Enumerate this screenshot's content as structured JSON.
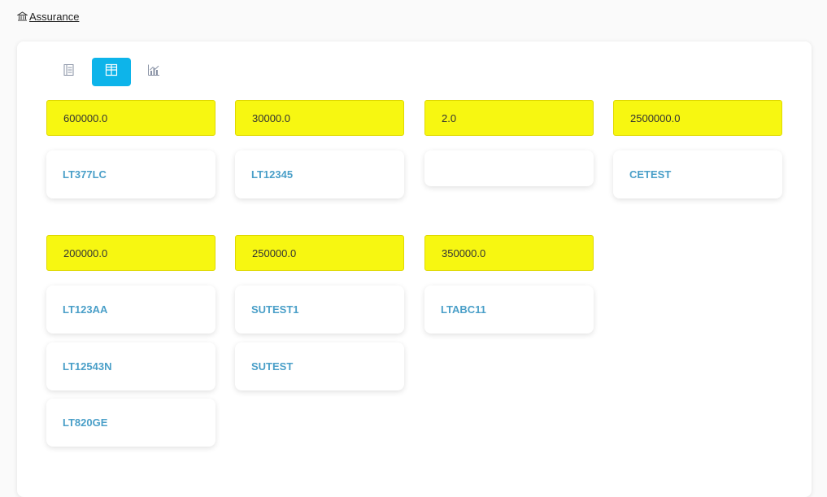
{
  "breadcrumb": {
    "label": "Assurance",
    "icon": "bank-icon"
  },
  "view_switcher": [
    {
      "icon": "list-view-icon",
      "active": false
    },
    {
      "icon": "grid-view-icon",
      "active": true
    },
    {
      "icon": "chart-view-icon",
      "active": false
    }
  ],
  "accent_color": "#0db4ea",
  "highlight_color": "#f7f711",
  "groups": [
    {
      "value": "600000.0",
      "cards": [
        "LT377LC"
      ]
    },
    {
      "value": "30000.0",
      "cards": [
        "LT12345"
      ]
    },
    {
      "value": "2.0",
      "cards": [
        ""
      ]
    },
    {
      "value": "2500000.0",
      "cards": [
        "CETEST"
      ]
    },
    {
      "value": "200000.0",
      "cards": [
        "LT123AA",
        "LT12543N",
        "LT820GE"
      ]
    },
    {
      "value": "250000.0",
      "cards": [
        "SUTEST1",
        "SUTEST"
      ]
    },
    {
      "value": "350000.0",
      "cards": [
        "LTABC11"
      ]
    }
  ]
}
